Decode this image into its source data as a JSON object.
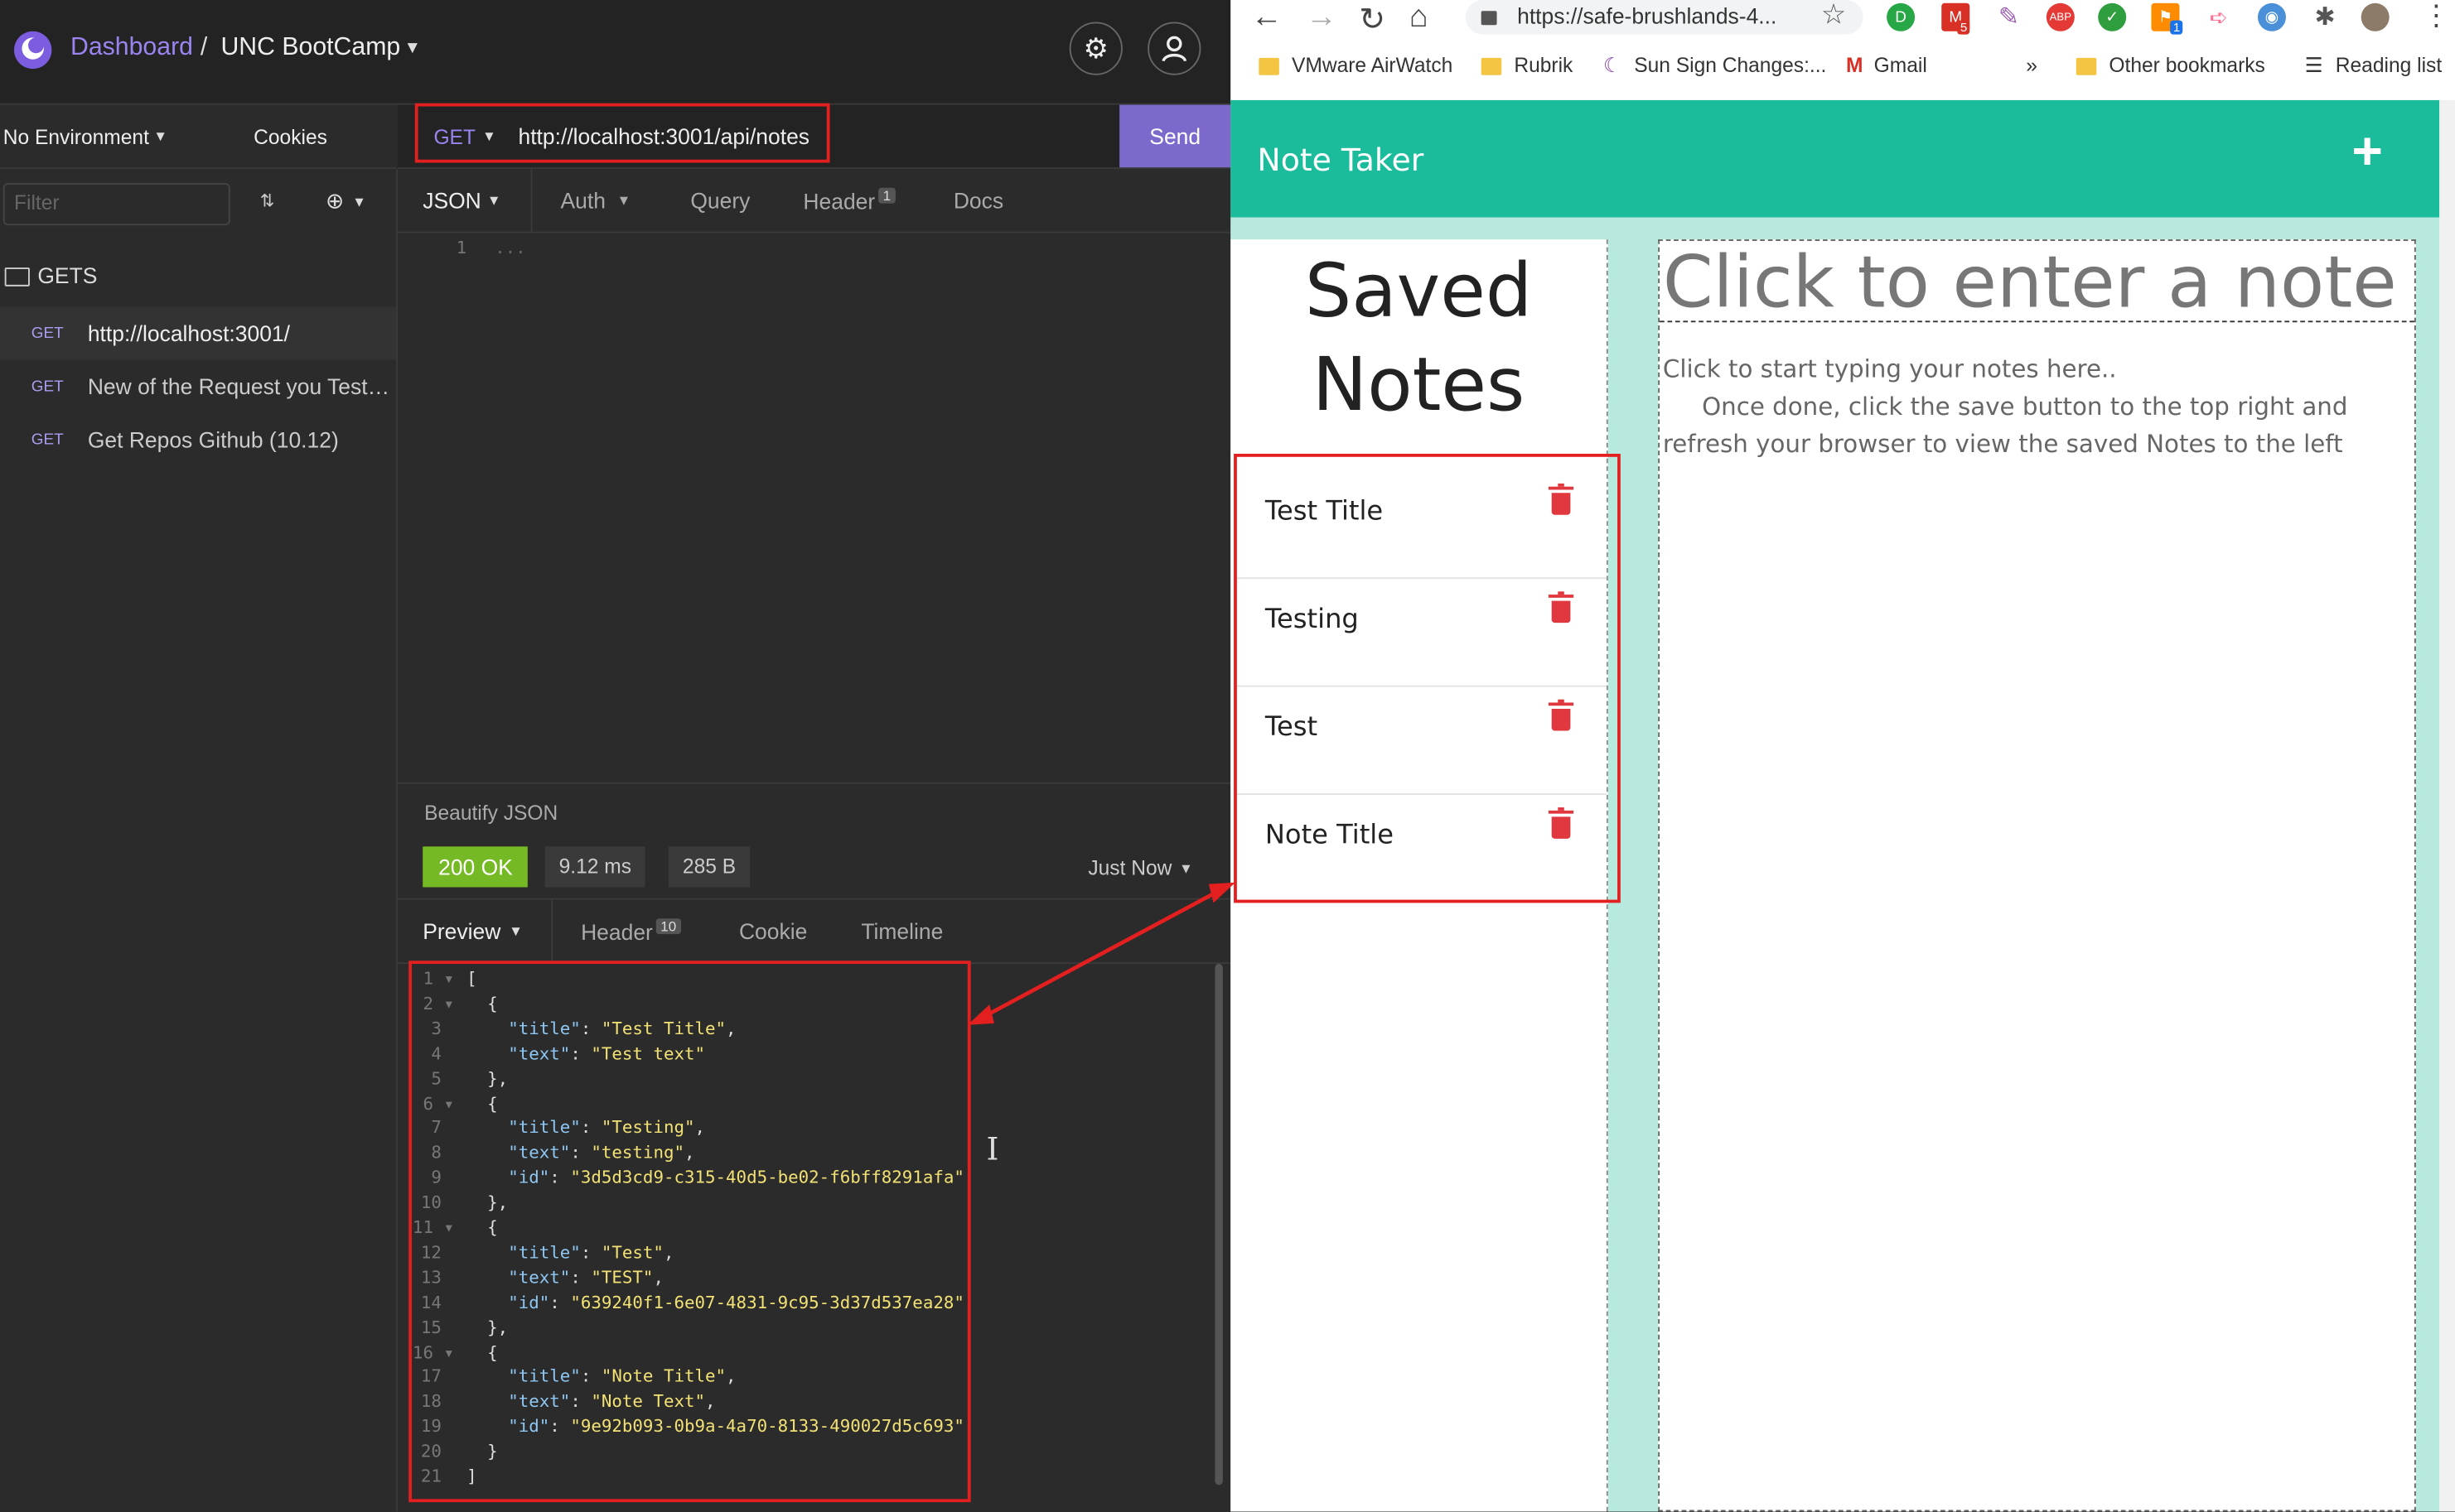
{
  "insomnia": {
    "breadcrumb_root": "Dashboard",
    "breadcrumb_sep": "/",
    "workspace": "UNC BootCamp",
    "environment": "No Environment",
    "cookies": "Cookies",
    "filter_placeholder": "Filter",
    "folder": "GETS",
    "requests": [
      {
        "verb": "GET",
        "name": "http://localhost:3001/"
      },
      {
        "verb": "GET",
        "name": "New of the Request you Test ( ..."
      },
      {
        "verb": "GET",
        "name": "Get Repos Github (10.12)"
      }
    ],
    "method": "GET",
    "url": "http://localhost:3001/api/notes",
    "send": "Send",
    "request_tabs": {
      "body": "JSON",
      "auth": "Auth",
      "query": "Query",
      "header": "Header",
      "header_count": "1",
      "docs": "Docs"
    },
    "request_body_line_no": "1",
    "request_body_text": "...",
    "beautify": "Beautify JSON",
    "status": "200 OK",
    "time": "9.12 ms",
    "size": "285 B",
    "timestamp": "Just Now",
    "response_tabs": {
      "preview": "Preview",
      "header": "Header",
      "header_count": "10",
      "cookie": "Cookie",
      "timeline": "Timeline"
    },
    "response_lines": [
      "[",
      "  {",
      "    \"title\": \"Test Title\",",
      "    \"text\": \"Test text\"",
      "  },",
      "  {",
      "    \"title\": \"Testing\",",
      "    \"text\": \"testing\",",
      "    \"id\": \"3d5d3cd9-c315-40d5-be02-f6bff8291afa\"",
      "  },",
      "  {",
      "    \"title\": \"Test\",",
      "    \"text\": \"TEST\",",
      "    \"id\": \"639240f1-6e07-4831-9c95-3d37d537ea28\"",
      "  },",
      "  {",
      "    \"title\": \"Note Title\",",
      "    \"text\": \"Note Text\",",
      "    \"id\": \"9e92b093-0b9a-4a70-8133-490027d5c693\"",
      "  }",
      "]"
    ]
  },
  "browser": {
    "address": "https://safe-brushlands-4...",
    "bookmarks": [
      "VMware AirWatch",
      "Rubrik",
      "Sun Sign Changes:...",
      "Gmail"
    ],
    "overflow": "»",
    "other_bookmarks": "Other bookmarks",
    "reading_list": "Reading list",
    "ext_badges": [
      "5",
      "1"
    ],
    "ext_abp": "ABP"
  },
  "app": {
    "title": "Note Taker",
    "heading": "Saved Notes",
    "notes": [
      "Test Title",
      "Testing",
      "Test",
      "Note Title"
    ],
    "title_placeholder": "Click to enter a note t",
    "body_placeholder_1": "Click to start typing your notes here..",
    "body_placeholder_2": "Once done, click the save button to the top right and refresh your browser to view the saved Notes to the left"
  },
  "colors": {
    "accent": "#7d69cb",
    "status_ok": "#75ba24",
    "note_header": "#1abc9c",
    "annotation": "#e41f1f"
  }
}
